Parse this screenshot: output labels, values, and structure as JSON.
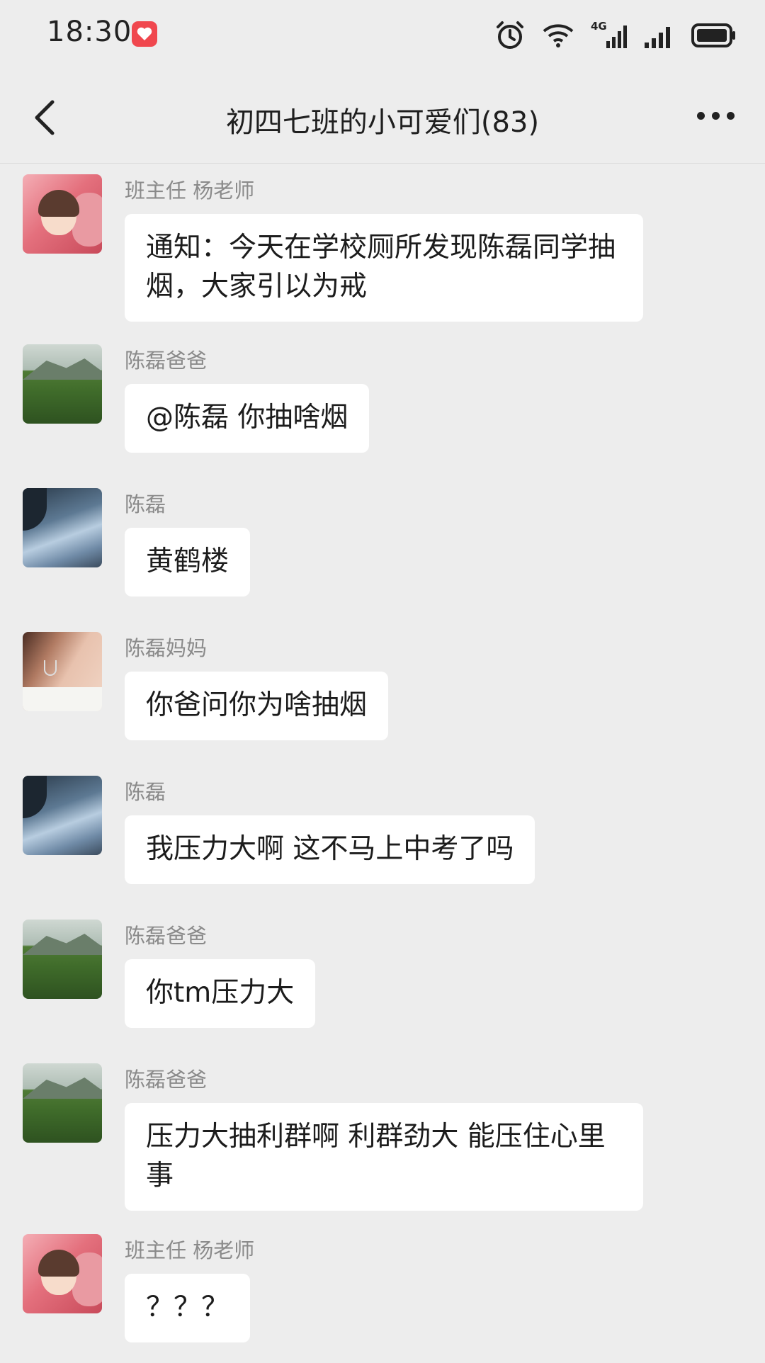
{
  "status_bar": {
    "time": "18:30",
    "network_label": "4G",
    "icons": [
      "app-badge-icon",
      "alarm-icon",
      "wifi-icon",
      "cellular-4g-icon",
      "cellular-signal-icon",
      "battery-icon"
    ]
  },
  "header": {
    "title": "初四七班的小可爱们(83)",
    "back_icon": "chevron-left-icon",
    "more_icon": "more-icon"
  },
  "messages": [
    {
      "sender": "班主任 杨老师",
      "avatar": "girl-avatar",
      "text": "通知：今天在学校厕所发现陈磊同学抽烟，大家引以为戒"
    },
    {
      "sender": "陈磊爸爸",
      "avatar": "mountain-avatar",
      "text": "@陈磊 你抽啥烟"
    },
    {
      "sender": "陈磊",
      "avatar": "sea-avatar",
      "text": "黄鹤楼"
    },
    {
      "sender": "陈磊妈妈",
      "avatar": "woman-avatar",
      "text": "你爸问你为啥抽烟"
    },
    {
      "sender": "陈磊",
      "avatar": "sea-avatar",
      "text": "我压力大啊 这不马上中考了吗"
    },
    {
      "sender": "陈磊爸爸",
      "avatar": "mountain-avatar",
      "text": "你tm压力大"
    },
    {
      "sender": "陈磊爸爸",
      "avatar": "mountain-avatar",
      "text": "压力大抽利群啊 利群劲大 能压住心里事"
    },
    {
      "sender": "班主任 杨老师",
      "avatar": "girl-avatar",
      "text": "？？？"
    }
  ]
}
